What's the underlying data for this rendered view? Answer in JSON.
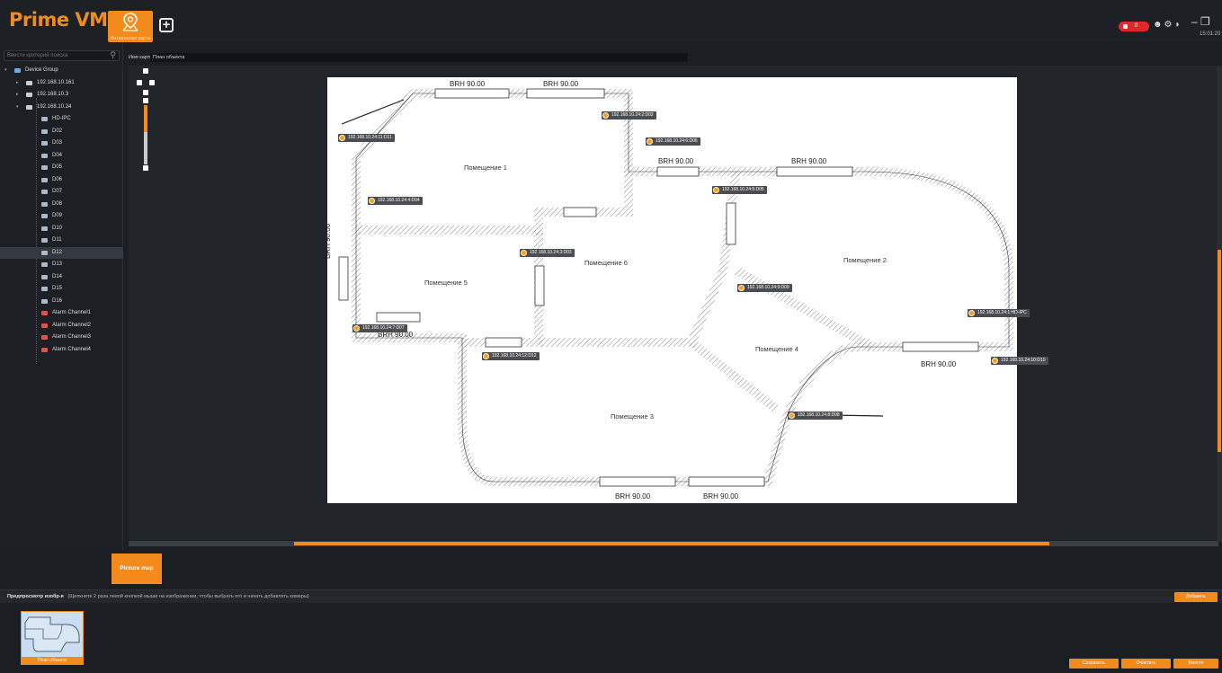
{
  "app": {
    "title": "Prime VMS",
    "map_tab_label": "Интуальная карта",
    "clock": "15:01:20",
    "alert_count": "0"
  },
  "colors": {
    "accent": "#f28a1c",
    "alert": "#e1262c",
    "background": "#1b1e22"
  },
  "search": {
    "placeholder": "Ввести критерий поиска"
  },
  "tree": [
    {
      "label": "Device Group",
      "level": 0,
      "type": "group"
    },
    {
      "label": "192.168.10.161",
      "level": 1,
      "type": "nvr"
    },
    {
      "label": "192.168.10.3",
      "level": 1,
      "type": "nvr"
    },
    {
      "label": "192.168.10.24",
      "level": 1,
      "type": "nvr"
    },
    {
      "label": "HD-IPC",
      "level": 2,
      "type": "camera"
    },
    {
      "label": "D02",
      "level": 2,
      "type": "camera"
    },
    {
      "label": "D03",
      "level": 2,
      "type": "camera"
    },
    {
      "label": "D04",
      "level": 2,
      "type": "camera"
    },
    {
      "label": "D05",
      "level": 2,
      "type": "camera"
    },
    {
      "label": "D06",
      "level": 2,
      "type": "camera"
    },
    {
      "label": "D07",
      "level": 2,
      "type": "camera"
    },
    {
      "label": "D08",
      "level": 2,
      "type": "camera"
    },
    {
      "label": "D09",
      "level": 2,
      "type": "camera"
    },
    {
      "label": "D10",
      "level": 2,
      "type": "camera"
    },
    {
      "label": "D11",
      "level": 2,
      "type": "camera"
    },
    {
      "label": "D12",
      "level": 2,
      "type": "camera",
      "selected": true
    },
    {
      "label": "D13",
      "level": 2,
      "type": "camera"
    },
    {
      "label": "D14",
      "level": 2,
      "type": "camera"
    },
    {
      "label": "D15",
      "level": 2,
      "type": "camera"
    },
    {
      "label": "D16",
      "level": 2,
      "type": "camera"
    },
    {
      "label": "Alarm Channel1",
      "level": 2,
      "type": "alarm"
    },
    {
      "label": "Alarm Channel2",
      "level": 2,
      "type": "alarm"
    },
    {
      "label": "Alarm Channel3",
      "level": 2,
      "type": "alarm"
    },
    {
      "label": "Alarm Channel4",
      "level": 2,
      "type": "alarm"
    }
  ],
  "map": {
    "name_label": "Имя карты",
    "name_value": "План объекта",
    "rooms": [
      "Помещение 1",
      "Помещение 2",
      "Помещение 3",
      "Помещение 4",
      "Помещение 5",
      "Помещение 6"
    ],
    "window_label": "BRH 90.00",
    "cameras": [
      "192.168.10.24:2:D02",
      "192.168.10.24:11:D11",
      "192.168.10.24:6:D06",
      "192.168.10.24:5:D05",
      "192.168.10.24:4:D04",
      "192.168.10.24:3:D03",
      "192.168.10.24:9:D09",
      "192.168.10.24:1:HD-IPC",
      "192.168.10.24:7:D07",
      "192.168.10.24:12:D12",
      "192.168.10.24:10:D10",
      "192.168.10.24:8:D08"
    ]
  },
  "bottom": {
    "tab_label": "Picture map",
    "preview_title": "Предпросмотр изобр-я",
    "preview_hint": "(Щелкните 2 раза левой кнопкой мыши на изображении, чтобы выбрать его и начать добавлять камеры)",
    "add_button": "Добавить",
    "thumb_caption": "План объекта",
    "save_button": "Сохранить",
    "clear_button": "Очистить",
    "delete_button": "Вместе"
  }
}
